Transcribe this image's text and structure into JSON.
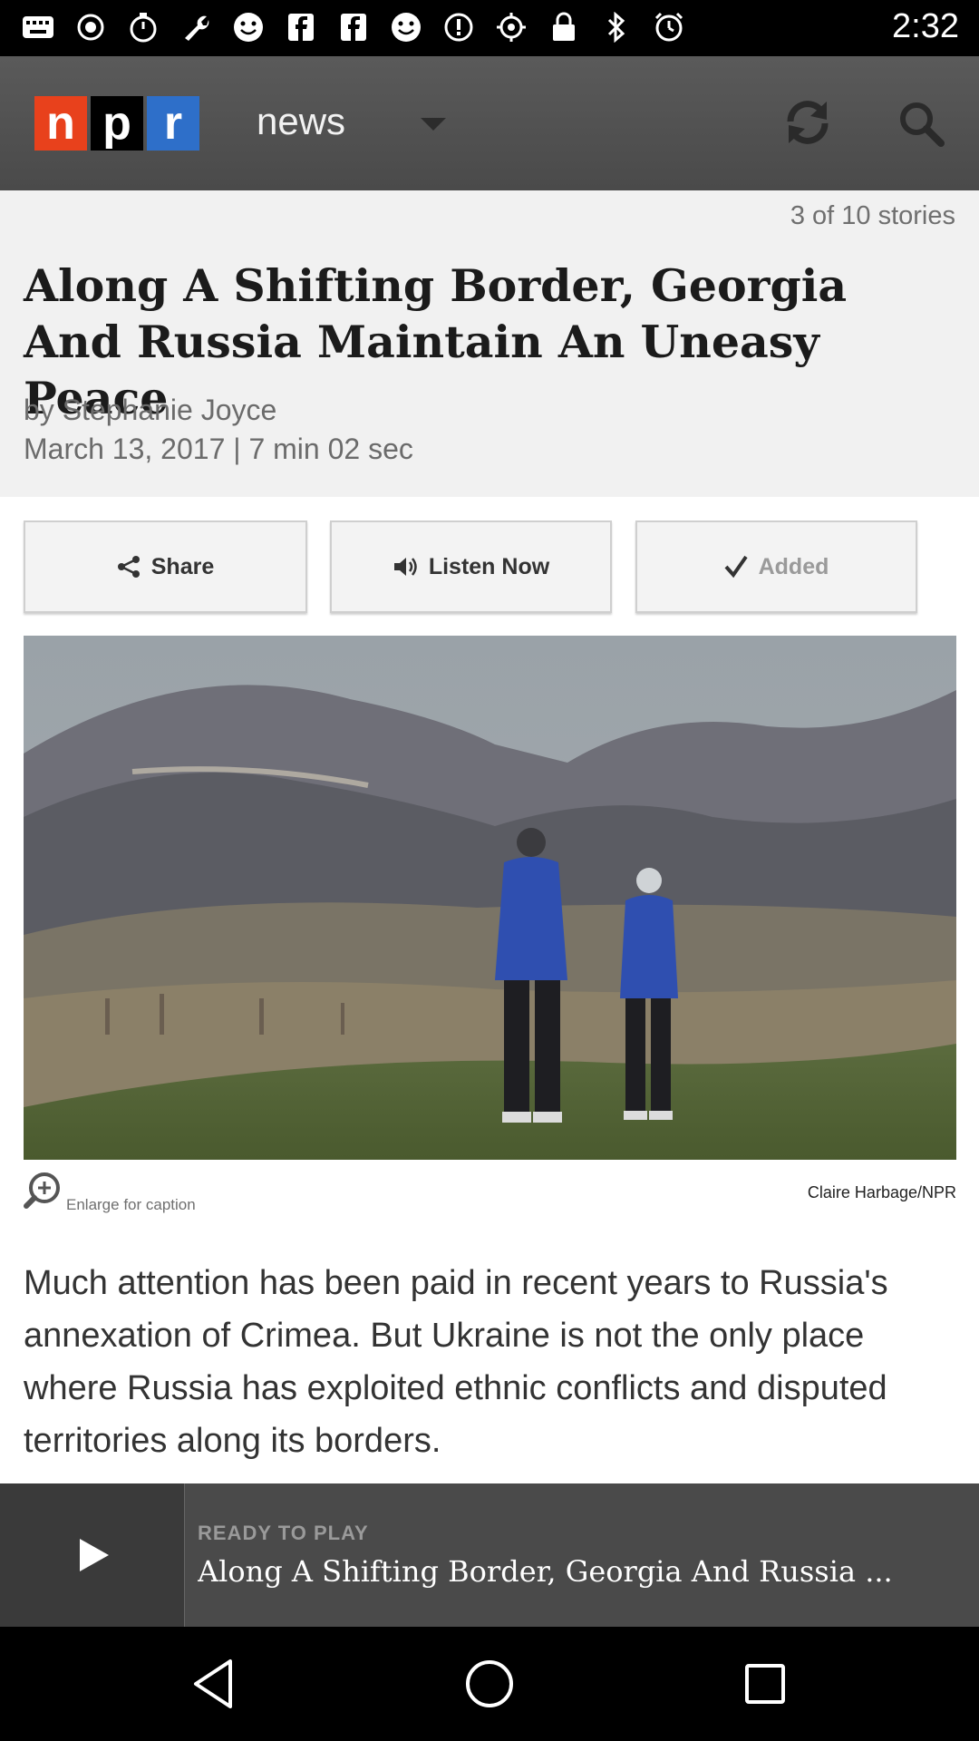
{
  "status_bar": {
    "time": "2:32",
    "icons": [
      "keyboard-icon",
      "record-icon",
      "timer-icon",
      "wrench-icon",
      "smiley-icon",
      "facebook-icon",
      "facebook-icon",
      "smiley-icon",
      "info-icon",
      "location-icon",
      "lock-icon",
      "bluetooth-icon",
      "alarm-icon"
    ]
  },
  "app_bar": {
    "logo_letters": [
      "n",
      "p",
      "r"
    ],
    "section": "news",
    "colors": {
      "n": "#e8411c",
      "p": "#000000",
      "r": "#2e6fc9"
    }
  },
  "story": {
    "position": "3 of 10 stories",
    "headline": "Along A Shifting Border, Georgia And Russia Maintain An Uneasy Peace",
    "byline": "by Stephanie Joyce",
    "date_duration": "March 13, 2017 | 7 min 02 sec"
  },
  "actions": {
    "share": "Share",
    "listen": "Listen Now",
    "added": "Added"
  },
  "photo": {
    "enlarge": "Enlarge for caption",
    "credit": "Claire Harbage/NPR"
  },
  "body": {
    "paragraph": "Much attention has been paid in recent years to Russia's annexation of Crimea. But Ukraine is not the only place where Russia has exploited ethnic conflicts and disputed territories along its borders."
  },
  "player": {
    "status": "READY TO PLAY",
    "title": "Along A Shifting Border, Georgia And Russia ..."
  }
}
